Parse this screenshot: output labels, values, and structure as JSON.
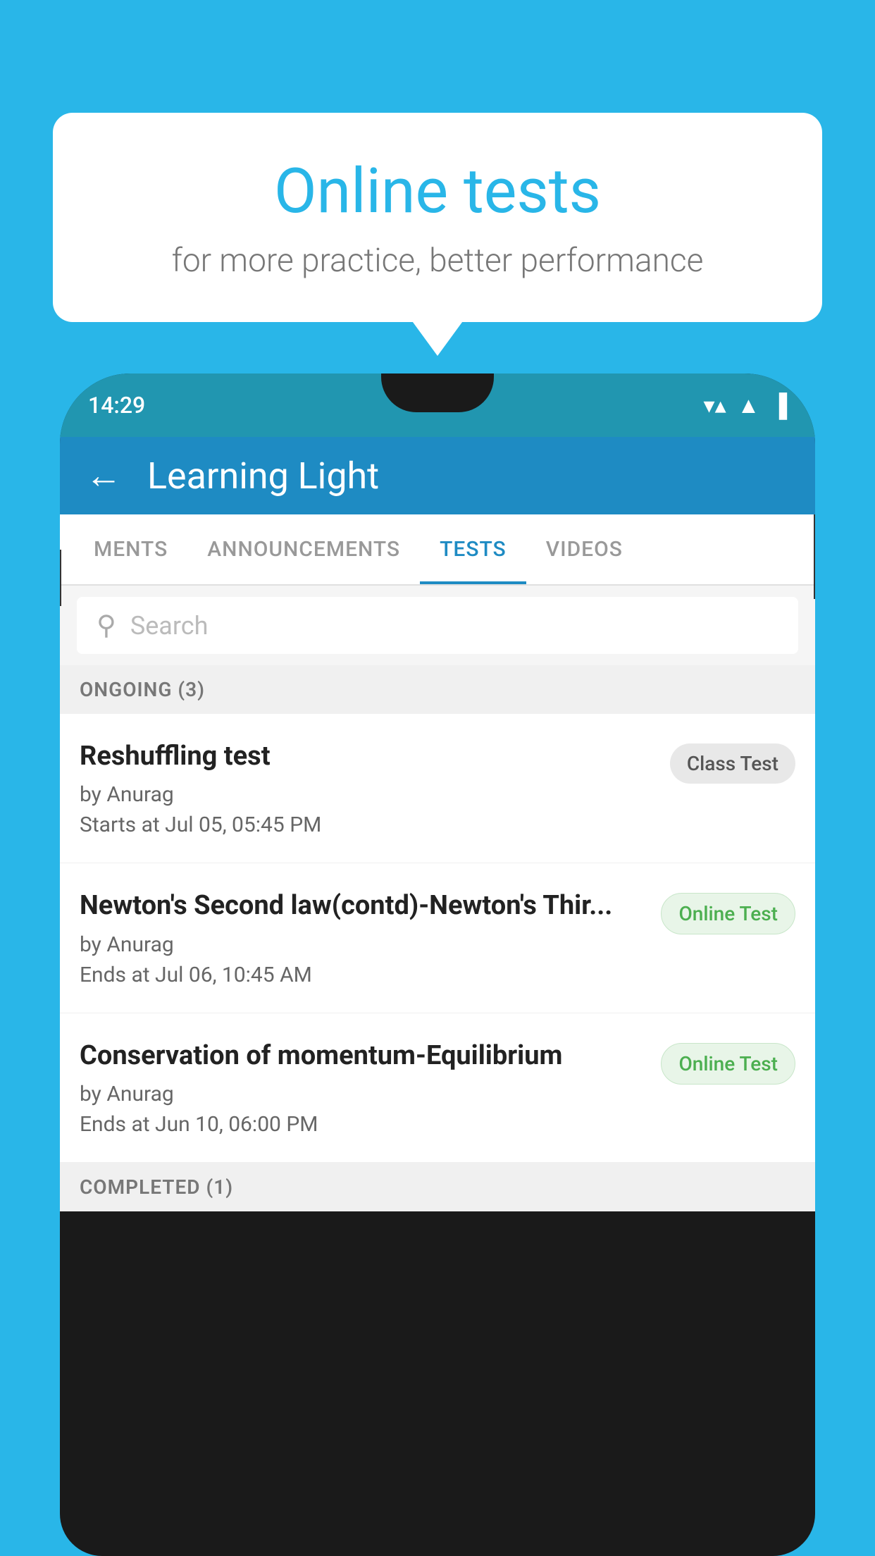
{
  "background_color": "#29b6e8",
  "bubble": {
    "title": "Online tests",
    "subtitle": "for more practice, better performance"
  },
  "phone": {
    "status_bar": {
      "time": "14:29",
      "wifi": "▼",
      "signal": "▲",
      "battery": "▌"
    },
    "header": {
      "title": "Learning Light",
      "back_label": "←"
    },
    "tabs": [
      {
        "label": "MENTS",
        "active": false
      },
      {
        "label": "ANNOUNCEMENTS",
        "active": false
      },
      {
        "label": "TESTS",
        "active": true
      },
      {
        "label": "VIDEOS",
        "active": false
      }
    ],
    "search": {
      "placeholder": "Search"
    },
    "sections": [
      {
        "header": "ONGOING (3)",
        "items": [
          {
            "title": "Reshuffling test",
            "author": "by Anurag",
            "time": "Starts at  Jul 05, 05:45 PM",
            "badge": "Class Test",
            "badge_type": "class"
          },
          {
            "title": "Newton's Second law(contd)-Newton's Thir...",
            "author": "by Anurag",
            "time": "Ends at  Jul 06, 10:45 AM",
            "badge": "Online Test",
            "badge_type": "online"
          },
          {
            "title": "Conservation of momentum-Equilibrium",
            "author": "by Anurag",
            "time": "Ends at  Jun 10, 06:00 PM",
            "badge": "Online Test",
            "badge_type": "online"
          }
        ]
      }
    ],
    "completed_header": "COMPLETED (1)"
  }
}
